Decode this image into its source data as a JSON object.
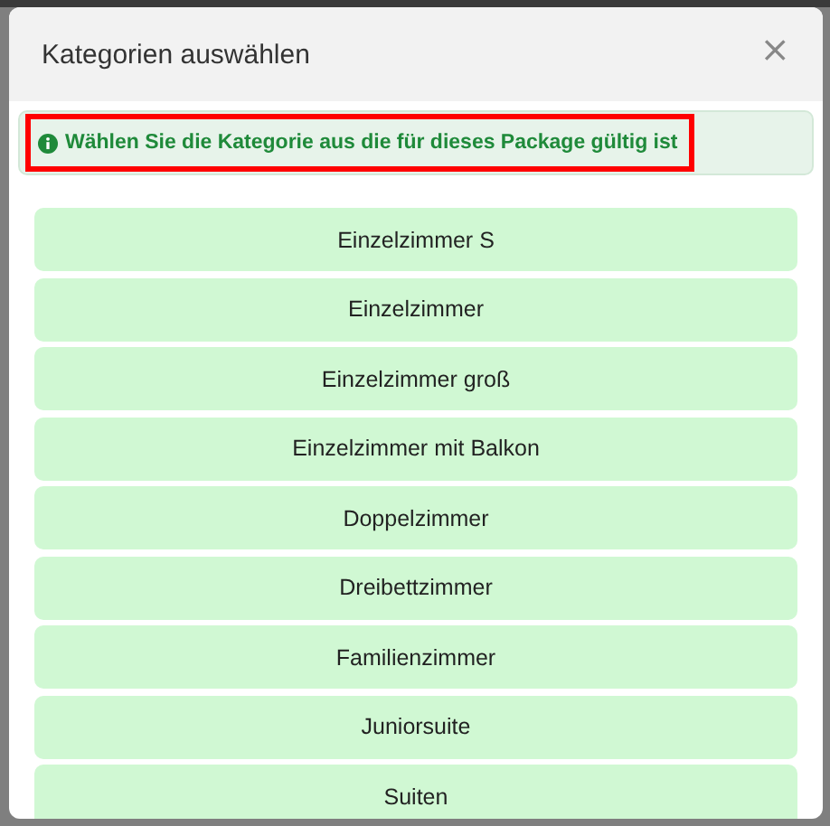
{
  "dialog": {
    "title": "Kategorien auswählen",
    "close": "×"
  },
  "notice": {
    "text": "Wählen Sie die Kategorie aus die für dieses Package gültig ist",
    "highlighted": true
  },
  "categories": [
    {
      "label": "Einzelzimmer S"
    },
    {
      "label": "Einzelzimmer"
    },
    {
      "label": "Einzelzimmer groß"
    },
    {
      "label": "Einzelzimmer mit Balkon"
    },
    {
      "label": "Doppelzimmer"
    },
    {
      "label": "Dreibettzimmer"
    },
    {
      "label": "Familienzimmer"
    },
    {
      "label": "Juniorsuite"
    },
    {
      "label": "Suiten"
    }
  ]
}
